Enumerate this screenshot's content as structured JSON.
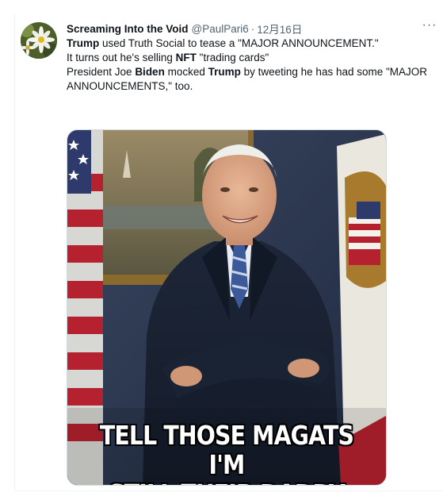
{
  "tweet": {
    "author_name": "Screaming Into the Void",
    "handle": "@PaulPari6",
    "separator": "·",
    "date": "12月16日",
    "more_label": "···",
    "paragraphs": [
      [
        {
          "text": "Trump",
          "bold": true
        },
        {
          "text": " used Truth Social to tease a \"MAJOR ANNOUNCEMENT.\"",
          "bold": false
        }
      ],
      [
        {
          "text": "It turns out he's selling ",
          "bold": false
        },
        {
          "text": "NFT",
          "bold": true
        },
        {
          "text": " \"trading cards\"",
          "bold": false
        }
      ],
      [
        {
          "text": "President Joe ",
          "bold": false
        },
        {
          "text": "Biden",
          "bold": true
        },
        {
          "text": " mocked ",
          "bold": false
        },
        {
          "text": "Trump",
          "bold": true
        },
        {
          "text": " by tweeting he has had some \"MAJOR ANNOUNCEMENTS,\" too.",
          "bold": false
        }
      ]
    ],
    "media": {
      "caption_line1": "TELL THOSE MAGATS I'M",
      "caption_line2": "STILL THEIR DADDY"
    }
  }
}
